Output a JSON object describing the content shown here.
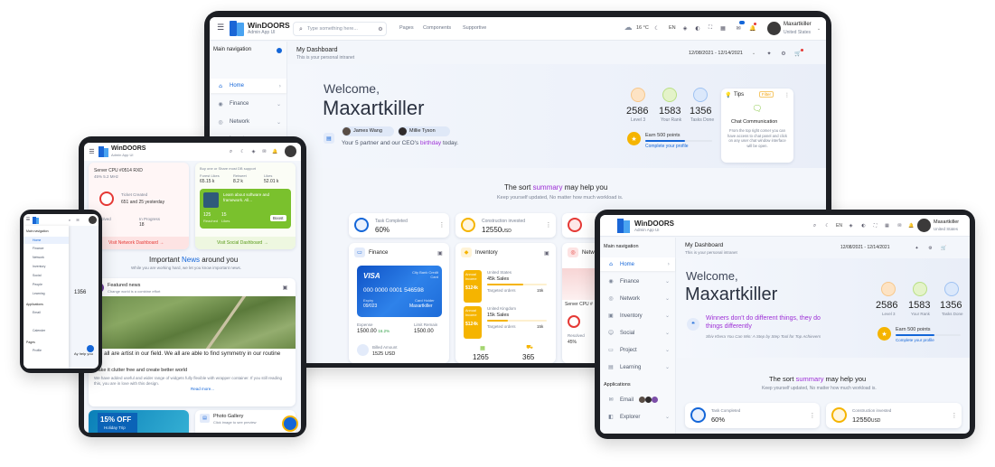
{
  "app": {
    "name": "WinDOORS",
    "subtitle": "Admin App UI"
  },
  "header": {
    "search_placeholder": "Type something here...",
    "links": [
      "Pages",
      "Components",
      "Supportive"
    ],
    "weather": "16 °C",
    "language": "EN",
    "user_name": "Maxartkiller",
    "user_location": "United States"
  },
  "sidebar": {
    "title": "Main navigation",
    "items": [
      "Home",
      "Finance",
      "Network",
      "Inventory",
      "Social",
      "Project",
      "Learning"
    ],
    "applications_title": "Applications",
    "apps": [
      "Email",
      "Explorer"
    ]
  },
  "dashboard": {
    "title": "My Dashboard",
    "subtitle": "This is your personal intranet",
    "date_range": "12/08/2021 - 12/14/2021",
    "welcome": "Welcome,",
    "user": "Maxartkiller",
    "friends": [
      "James Wang",
      "Millie Tyson"
    ],
    "birthday_pre": "Your 5 partner and our CEO's",
    "birthday_word": "birthday",
    "birthday_post": "today.",
    "quote": "Winners don't do different things, they do things differently",
    "quote_sub": "Shiv Khera You Can Win: A Step by Step Tool for Top Achievers",
    "stats": [
      {
        "value": "2586",
        "label": "Level 3"
      },
      {
        "value": "1583",
        "label": "Your Rank"
      },
      {
        "value": "1356",
        "label": "Tasks Done"
      }
    ],
    "points_title": "Earn 500 points",
    "points_link": "Complete your profile",
    "points_progress": 0.6,
    "tips": {
      "title": "Tips",
      "badge": "Filter",
      "heading": "Chat Communication",
      "body": "From the top right corner you can have access to chat panel and click on any user chat window interface will be open."
    }
  },
  "summary": {
    "title_pre": "The sort",
    "title_em": "summary",
    "title_post": "may help you",
    "sub": "Keep yourself updated, No matter how much workload is."
  },
  "kpis": [
    {
      "label": "Task Completed",
      "value": "60%"
    },
    {
      "label": "Construction invested",
      "value": "12550",
      "unit": "USD"
    }
  ],
  "finance": {
    "title": "Finance",
    "card_brand": "VISA",
    "card_type": "City Bank Credit Card",
    "card_number": "000 0000 0001 546598",
    "expiry_label": "Expiry",
    "expiry": "09/023",
    "holder_label": "Card Holder",
    "holder": "Maxartkiller",
    "expense_label": "Expense",
    "expense": "1500.00",
    "expense_change": "16.2%",
    "limit_label": "Limit Remain",
    "limit": "1500.00",
    "billed_label": "Billed Amount",
    "billed": "1525 USD"
  },
  "inventory": {
    "title": "Inventory",
    "annual1": "Annual Income",
    "annual1_val": "$124k",
    "region1": "United States",
    "region1_sales": "45k Sales",
    "targeted1": "Targeted orders",
    "targeted1_val": "15k",
    "annual2": "Annual Income",
    "annual2_val": "$124k",
    "region2": "United Kingdom",
    "region2_sales": "15k Sales",
    "targeted2": "Targeted orders",
    "targeted2_val": "15k",
    "stock": "1265",
    "stock_label": "In Stock",
    "delivered": "365",
    "delivered_label": "Delivered"
  },
  "network": {
    "title": "Network",
    "server": "Server CPU #",
    "resolved": "Resolved",
    "resolved_val": "45%",
    "inprog": "In Progress"
  },
  "tablet": {
    "server": "Server CPU #0514 RXD",
    "server_sub": "45% 5.2 MHz",
    "ticket": "Ticket Created",
    "ticket_sub": "651 and 25 yesterday",
    "resolved": "Resolved",
    "resolved_val": "45",
    "progress": "In Progress",
    "progress_val": "18",
    "network_link": "Visit Network Dashboard →",
    "buy": "Buy one or Share most DB support",
    "forest": "Forest Likes",
    "forest_val": "65.15 k",
    "retweet": "Retweet",
    "retweet_val": "8.2 k",
    "likes": "Likes",
    "likes_val": "52.01 k",
    "learn": "Learn about software and framework. All...",
    "learn_count": "125",
    "learn_count_label": "Reached",
    "learn_likes": "15",
    "learn_likes_label": "Likes",
    "boost": "Boost",
    "social_link": "Visit Social Dashboard →",
    "news_pre": "Important",
    "news_em": "News",
    "news_post": "around you",
    "news_sub": "While you are working hard, we let you know important news.",
    "featured": "Featured news",
    "featured_sub": "Change world is a combine effort",
    "artist": "We all are artist in our field. We all are able to find symmetry in our routine",
    "clutter": "Make it clutter free and create better world",
    "clutter_body": "We have added useful and wider range of widgets fully flexible with wrapper container. If you still reading this, you are in love with this design.",
    "read_more": "Read more...",
    "offer": "15% OFF",
    "offer_sub": "Holiday Trip",
    "gallery": "Photo Gallery",
    "gallery_sub": "Click image to see preview"
  },
  "phone": {
    "nav": "Main navigation",
    "items": [
      "Home",
      "Finance",
      "Network",
      "Inventory",
      "Social",
      "People",
      "Learning"
    ],
    "applications": "Applications",
    "email": "Email",
    "calendar": "Calender",
    "pages": "Pages",
    "profile": "Profile",
    "stat": "1356",
    "help": "Ay help you"
  },
  "colors": {
    "primary": "#1466d8",
    "accent": "#9d2fd6",
    "dark": "#1d1f24",
    "yellow": "#f5b400",
    "green": "#7ac12d"
  }
}
